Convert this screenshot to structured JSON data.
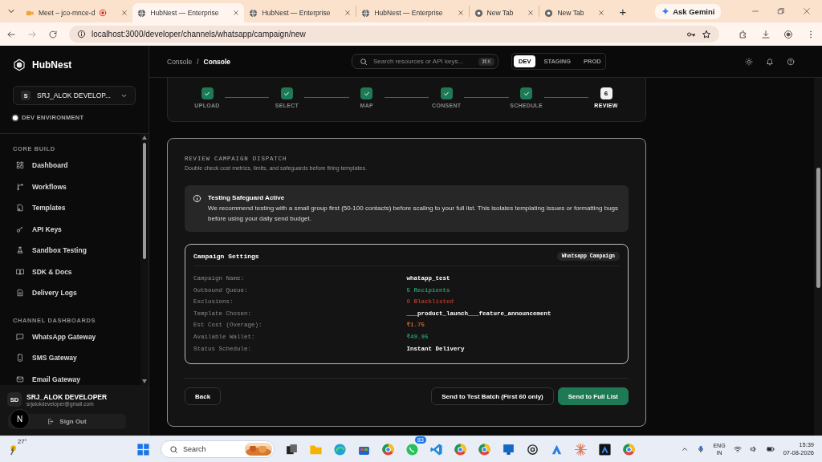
{
  "browser": {
    "tabs": [
      {
        "title": "Meet – jco-mnce-d",
        "kind": "meet",
        "selected": false
      },
      {
        "title": "HubNest — Enterprise",
        "kind": "page",
        "selected": true
      },
      {
        "title": "HubNest — Enterprise",
        "kind": "page",
        "selected": false
      },
      {
        "title": "HubNest — Enterprise",
        "kind": "page",
        "selected": false
      },
      {
        "title": "New Tab",
        "kind": "blank",
        "selected": false
      },
      {
        "title": "New Tab",
        "kind": "blank",
        "selected": false
      }
    ],
    "new_tab": "+",
    "assistant": "Ask Gemini",
    "address": "localhost:3000/developer/channels/whatsapp/campaign/new"
  },
  "sidebar": {
    "brand": "HubNest",
    "workspace": {
      "avatar": "S",
      "name": "SRJ_ALOK DEVELOP..."
    },
    "environment": "DEV ENVIRONMENT",
    "sections": [
      {
        "title": "CORE BUILD",
        "items": [
          "Dashboard",
          "Workflows",
          "Templates",
          "API Keys",
          "Sandbox Testing",
          "SDK & Docs",
          "Delivery Logs"
        ]
      },
      {
        "title": "CHANNEL DASHBOARDS",
        "items": [
          "WhatsApp Gateway",
          "SMS Gateway",
          "Email Gateway"
        ]
      }
    ],
    "user": {
      "initials": "SD",
      "name": "SRJ_ALOK DEVELOPER",
      "email": "srjalokdeveloper@gmail.com"
    },
    "dev_badge": "N",
    "sign_out": "Sign Out"
  },
  "topbar": {
    "breadcrumb": [
      "Console",
      "Console"
    ],
    "separator": "/",
    "search": {
      "placeholder": "Search resources or API keys...",
      "shortcut": "⌘K"
    },
    "environments": [
      {
        "label": "DEV",
        "selected": true
      },
      {
        "label": "STAGING",
        "selected": false
      },
      {
        "label": "PROD",
        "selected": false
      }
    ]
  },
  "stepper": [
    {
      "label": "UPLOAD",
      "done": true
    },
    {
      "label": "SELECT",
      "done": true
    },
    {
      "label": "MAP",
      "done": true
    },
    {
      "label": "CONSENT",
      "done": true
    },
    {
      "label": "SCHEDULE",
      "done": true
    },
    {
      "label": "REVIEW",
      "done": false,
      "number": "6"
    }
  ],
  "review": {
    "title": "REVIEW CAMPAIGN DISPATCH",
    "subtitle": "Double check cost metrics, limits, and safeguards before firing templates.",
    "alert": {
      "title": "Testing Safeguard Active",
      "body": "We recommend testing with a small group first (50-100 contacts) before scaling to your full list. This isolates templating issues or formatting bugs before using your daily send budget."
    },
    "settings": {
      "title": "Campaign Settings",
      "tag": "Whatsapp Campaign",
      "rows": [
        {
          "label": "Campaign Name:",
          "value": "whatapp_test",
          "color": "#ffffff"
        },
        {
          "label": "Outbound Queue:",
          "value": "5 Recipients",
          "color": "#2e8f66"
        },
        {
          "label": "Exclusions:",
          "value": "0 Blacklisted",
          "color": "#a3382a"
        },
        {
          "label": "Template Chosen:",
          "value": "___product_launch___feature_announcement",
          "color": "#ffffff"
        },
        {
          "label": "Est Cost (Overage):",
          "value": "₹1.75",
          "color": "#c8602a"
        },
        {
          "label": "Available Wallet:",
          "value": "₹49.95",
          "color": "#2e8f66"
        },
        {
          "label": "Status Schedule:",
          "value": "Instant Delivery",
          "color": "#ffffff"
        }
      ]
    },
    "buttons": {
      "back": "Back",
      "test": "Send to Test Batch (First 60 only)",
      "full": "Send to Full List"
    }
  },
  "taskbar": {
    "weather": "27°",
    "search": "Search",
    "whatsapp_badge": "83",
    "language": "ENG",
    "region": "IN",
    "time": "15:39",
    "date": "07-08-2026"
  }
}
